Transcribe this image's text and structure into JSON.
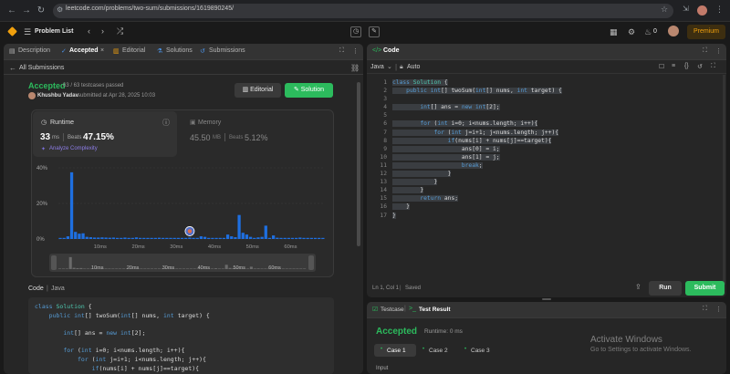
{
  "browser": {
    "url": "leetcode.com/problems/two-sum/submissions/1619890245/"
  },
  "header": {
    "problem_list": "Problem List",
    "premium": "Premium",
    "coins": "0"
  },
  "left_tabs": [
    {
      "label": "Description"
    },
    {
      "label": "Accepted"
    },
    {
      "label": "Editorial"
    },
    {
      "label": "Solutions"
    },
    {
      "label": "Submissions"
    }
  ],
  "submission": {
    "back_label": "All Submissions",
    "status": "Accepted",
    "testcases": "63 / 63 testcases passed",
    "user": "Khushbu Yadav",
    "submitted": "submitted at Apr 28, 2025 10:03",
    "editorial_btn": "Editorial",
    "solution_btn": "Solution"
  },
  "runtime": {
    "label": "Runtime",
    "value": "33",
    "unit": "ms",
    "beats_label": "Beats",
    "beats": "47.15%",
    "analyze": "Analyze Complexity"
  },
  "memory": {
    "label": "Memory",
    "value": "45.50",
    "unit": "MB",
    "beats_label": "Beats",
    "beats": "5.12%"
  },
  "chart_data": {
    "type": "bar",
    "ylim": [
      0,
      40
    ],
    "y_ticks": [
      "40%",
      "20%",
      "0%"
    ],
    "x_ticks": [
      "10ms",
      "20ms",
      "30ms",
      "40ms",
      "50ms",
      "60ms"
    ],
    "brush_ticks": [
      "10ms",
      "20ms",
      "30ms",
      "40ms",
      "50ms",
      "60ms"
    ],
    "values": [
      0.3,
      0.4,
      1.5,
      37.5,
      4.0,
      3.0,
      3.2,
      1.2,
      1.0,
      0.8,
      0.8,
      0.9,
      0.8,
      0.7,
      0.8,
      0.6,
      0.6,
      0.8,
      0.5,
      0.6,
      0.9,
      0.6,
      0.5,
      0.5,
      0.5,
      0.6,
      0.7,
      0.6,
      0.5,
      0.6,
      0.4,
      0.5,
      0.4,
      0.6,
      0.8,
      0.5,
      0.6,
      1.5,
      1.2,
      0.5,
      0.5,
      0.6,
      0.4,
      0.4,
      2.5,
      1.5,
      1.0,
      13.5,
      3.5,
      2.5,
      1.2,
      0.5,
      0.9,
      1.2,
      7.5,
      0.4,
      2.0,
      0.7,
      0.5,
      0.3,
      0.3,
      0.2,
      0.3,
      0.8,
      0.3,
      0.2,
      0.3,
      0.2,
      0.1,
      0.1
    ],
    "highlight_index": 34
  },
  "code_section": {
    "label": "Code",
    "language": "Java",
    "lines": [
      "class Solution {",
      "    public int[] twoSum(int[] nums, int target) {",
      "",
      "        int[] ans = new int[2];",
      "",
      "        for (int i=0; i<nums.length; i++){",
      "            for (int j=i+1; i<nums.length; j++){",
      "                if(nums[i] + nums[j]==target){"
    ]
  },
  "editor": {
    "title": "Code",
    "language": "Java",
    "mode": "Auto",
    "status": "Ln 1, Col 1",
    "saved": "Saved",
    "run_btn": "Run",
    "submit_btn": "Submit",
    "lines": [
      "class Solution {",
      "    public int[] twoSum(int[] nums, int target) {",
      "",
      "        int[] ans = new int[2];",
      "",
      "        for (int i=0; i<nums.length; i++){",
      "            for (int j=i+1; j<nums.length; j++){",
      "                if(nums[i] + nums[j]==target){",
      "                    ans[0] = i;",
      "                    ans[1] = j;",
      "                    break;",
      "                }",
      "            }",
      "        }",
      "        return ans;",
      "    }",
      "}"
    ]
  },
  "result": {
    "tab_testcase": "Testcase",
    "tab_result": "Test Result",
    "status": "Accepted",
    "runtime": "Runtime: 0 ms",
    "cases": [
      "Case 1",
      "Case 2",
      "Case 3"
    ],
    "input_label": "Input"
  },
  "watermark": {
    "title": "Activate Windows",
    "subtitle": "Go to Settings to activate Windows."
  },
  "colors": {
    "accent_green": "#2cbb5d",
    "bar_blue": "#1e6fe0",
    "premium": "#f0a00d"
  }
}
